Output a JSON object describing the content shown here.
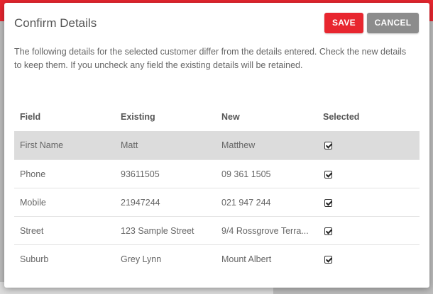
{
  "dialog": {
    "title": "Confirm Details",
    "save_label": "SAVE",
    "cancel_label": "CANCEL",
    "description": "The following details for the selected customer differ from the details entered. Check the new details to keep them. If you uncheck any field the existing details will be retained."
  },
  "table": {
    "headers": [
      "Field",
      "Existing",
      "New",
      "Selected"
    ],
    "rows": [
      {
        "field": "First Name",
        "existing": "Matt",
        "new": "Matthew",
        "selected": true
      },
      {
        "field": "Phone",
        "existing": "93611505",
        "new": "09 361 1505",
        "selected": true
      },
      {
        "field": "Mobile",
        "existing": "21947244",
        "new": "021 947 244",
        "selected": true
      },
      {
        "field": "Street",
        "existing": "123 Sample Street",
        "new": "9/4 Rossgrove Terra...",
        "selected": true
      },
      {
        "field": "Suburb",
        "existing": "Grey Lynn",
        "new": "Mount Albert",
        "selected": true
      }
    ]
  },
  "colors": {
    "accent": "#e8262f",
    "cancel": "#8c8c8c",
    "highlight_row": "#dcdcdc"
  }
}
